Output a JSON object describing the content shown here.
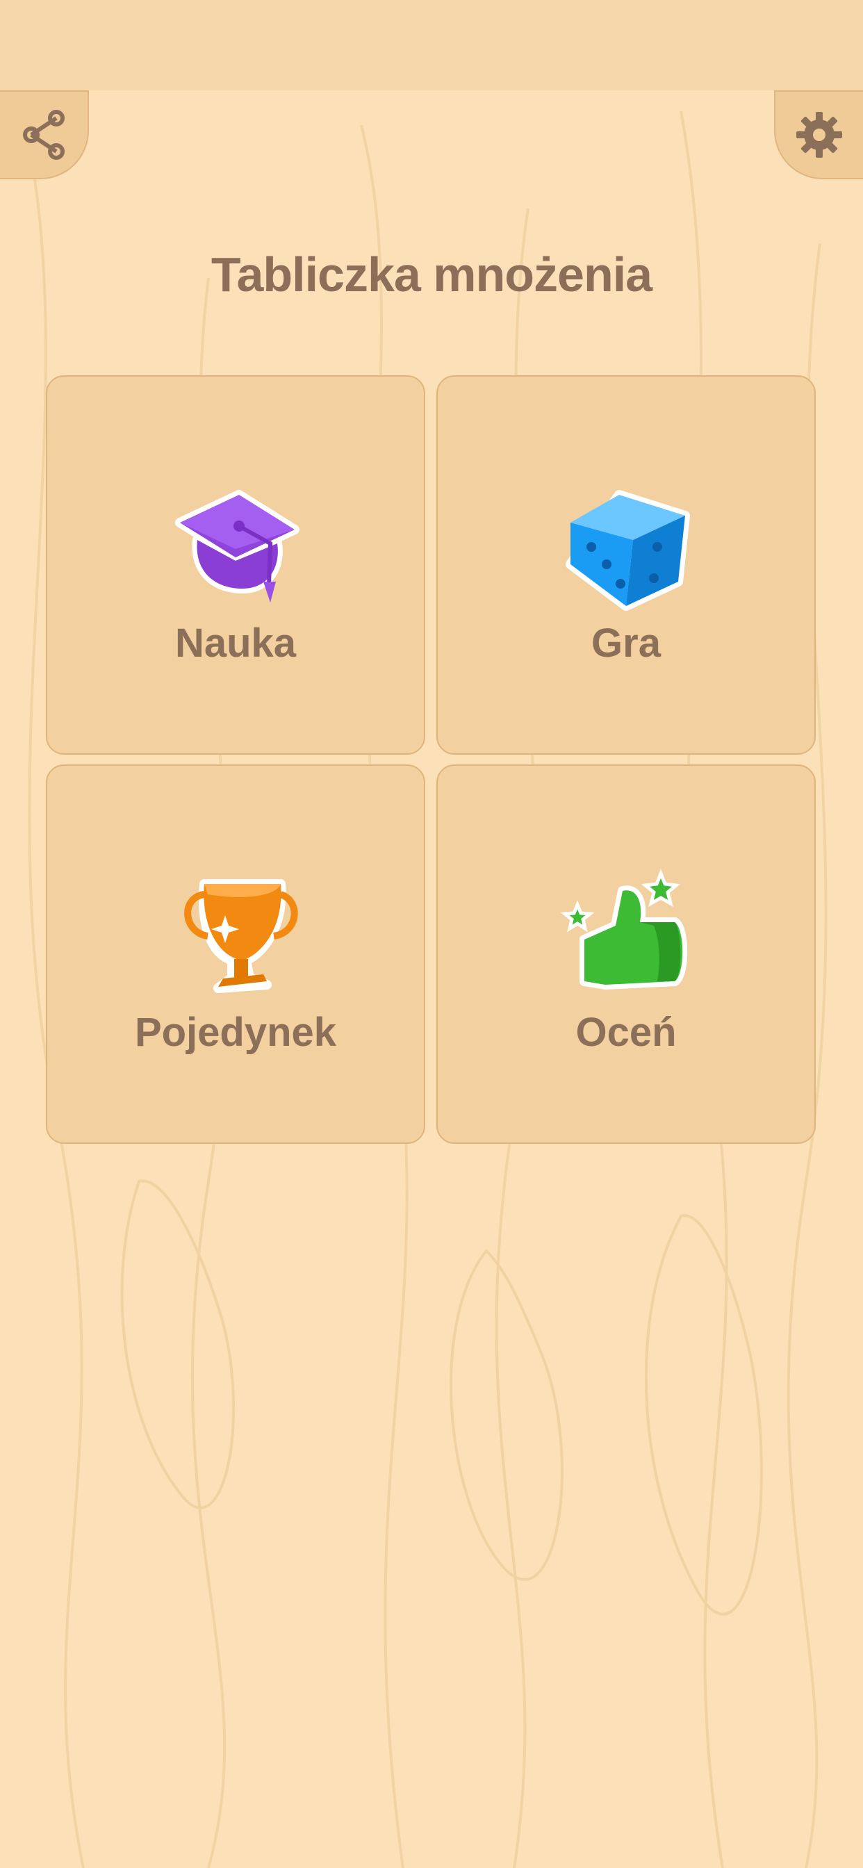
{
  "app": {
    "title": "Tabliczka mnożenia"
  },
  "toolbar": {
    "share_icon": "share-icon",
    "settings_icon": "gear-icon"
  },
  "menu": {
    "items": [
      {
        "label": "Nauka",
        "icon": "graduation-cap-icon",
        "color": "#9b4fe0"
      },
      {
        "label": "Gra",
        "icon": "dice-icon",
        "color": "#1a9cf5"
      },
      {
        "label": "Pojedynek",
        "icon": "trophy-icon",
        "color": "#f28a12"
      },
      {
        "label": "Oceń",
        "icon": "thumbs-up-icon",
        "color": "#34b233"
      }
    ]
  },
  "colors": {
    "background": "#fce1b8",
    "card": "#f2d09f",
    "text": "#8c6f58"
  }
}
